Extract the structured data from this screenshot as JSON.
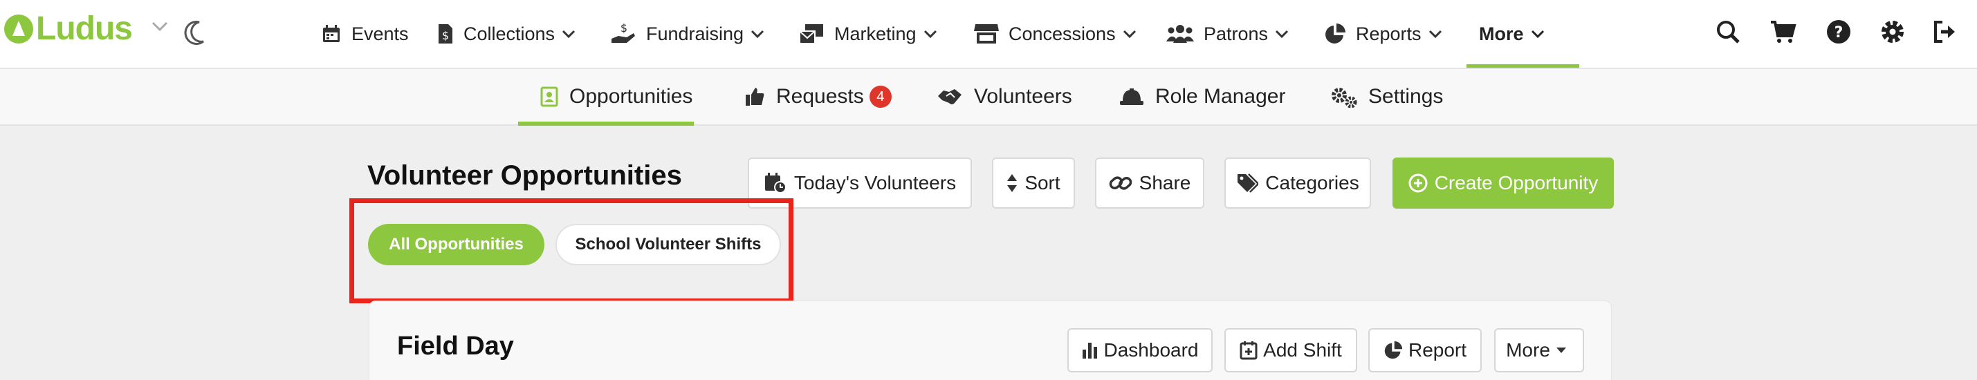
{
  "brand": {
    "name": "Ludus",
    "accent": "#8dc63f",
    "alert": "#e0352b",
    "highlight": "#e8241b"
  },
  "topnav": {
    "items": [
      {
        "label": "Events",
        "icon": "calendar-icon",
        "dropdown": false
      },
      {
        "label": "Collections",
        "icon": "money-file-icon",
        "dropdown": true
      },
      {
        "label": "Fundraising",
        "icon": "donation-hand-icon",
        "dropdown": true
      },
      {
        "label": "Marketing",
        "icon": "mail-bulk-icon",
        "dropdown": true
      },
      {
        "label": "Concessions",
        "icon": "store-icon",
        "dropdown": true
      },
      {
        "label": "Patrons",
        "icon": "users-icon",
        "dropdown": true
      },
      {
        "label": "Reports",
        "icon": "pie-chart-icon",
        "dropdown": true
      },
      {
        "label": "More",
        "icon": "",
        "dropdown": true,
        "active": true
      }
    ],
    "right_icons": [
      "search-icon",
      "cart-icon",
      "help-icon",
      "gear-icon",
      "sign-out-icon"
    ]
  },
  "subnav": {
    "items": [
      {
        "label": "Opportunities",
        "icon": "contact-card-icon",
        "active": true
      },
      {
        "label": "Requests",
        "icon": "thumbs-up-icon",
        "badge": "4"
      },
      {
        "label": "Volunteers",
        "icon": "handshake-icon"
      },
      {
        "label": "Role Manager",
        "icon": "hard-hat-icon"
      },
      {
        "label": "Settings",
        "icon": "gears-icon"
      }
    ]
  },
  "main": {
    "title": "Volunteer Opportunities",
    "toolbar": {
      "todays_volunteers": "Today's Volunteers",
      "sort": "Sort",
      "share": "Share",
      "categories": "Categories",
      "create": "Create Opportunity"
    },
    "filters": [
      {
        "label": "All Opportunities",
        "active": true
      },
      {
        "label": "School Volunteer Shifts",
        "active": false
      }
    ],
    "card": {
      "title": "Field Day",
      "actions": {
        "dashboard": "Dashboard",
        "add_shift": "Add Shift",
        "report": "Report",
        "more": "More"
      }
    }
  }
}
